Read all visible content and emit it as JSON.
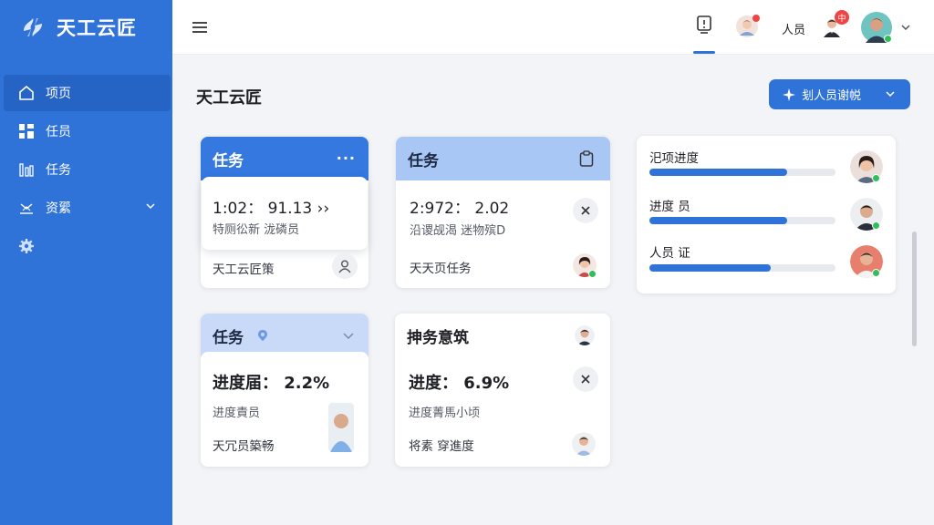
{
  "brand": {
    "name": "天工云匠",
    "accent": "#2f73d8"
  },
  "sidebar": {
    "items": [
      {
        "label": "项页",
        "icon": "home-icon",
        "active": true
      },
      {
        "label": "任员",
        "icon": "grid-icon",
        "active": false
      },
      {
        "label": "任务",
        "icon": "bar-icon",
        "active": false
      },
      {
        "label": "资綤",
        "icon": "resource-icon",
        "active": false,
        "expandable": true
      },
      {
        "label": "",
        "icon": "gear-icon",
        "active": false
      }
    ]
  },
  "topbar": {
    "menu_icon": "hamburger-icon",
    "user_label": "人员",
    "badge_text": "中"
  },
  "page": {
    "title": "天工云匠",
    "action_button": "刬人员谢帨"
  },
  "cards": {
    "c1": {
      "title": "任务",
      "metric": "1:02： 91.13 ››",
      "subtitle": "特厕彸新 泷磷员",
      "footer": "天工云匠策"
    },
    "c2": {
      "title": "任务",
      "metric": "2:972： 2.02",
      "subtitle": "沿谡觇渴 迷物殡D",
      "footer": "天天页任务"
    },
    "c3": {
      "title": "任务",
      "metric": "进度届： 2.2%",
      "subtitle": "进度責员",
      "footer": "天冗员築畅"
    },
    "c4": {
      "title": "抻务意筑",
      "metric": "进度： 6.9%",
      "subtitle": "进度菁馬小顷",
      "footer": "将素 穿進度"
    }
  },
  "progress": {
    "items": [
      {
        "label": "汜项进度",
        "value": 0.74
      },
      {
        "label": "进度 员",
        "value": 0.74
      },
      {
        "label": "人员 证",
        "value": 0.65
      }
    ]
  },
  "colors": {
    "online": "#2fbf5a",
    "alert": "#f04444"
  }
}
